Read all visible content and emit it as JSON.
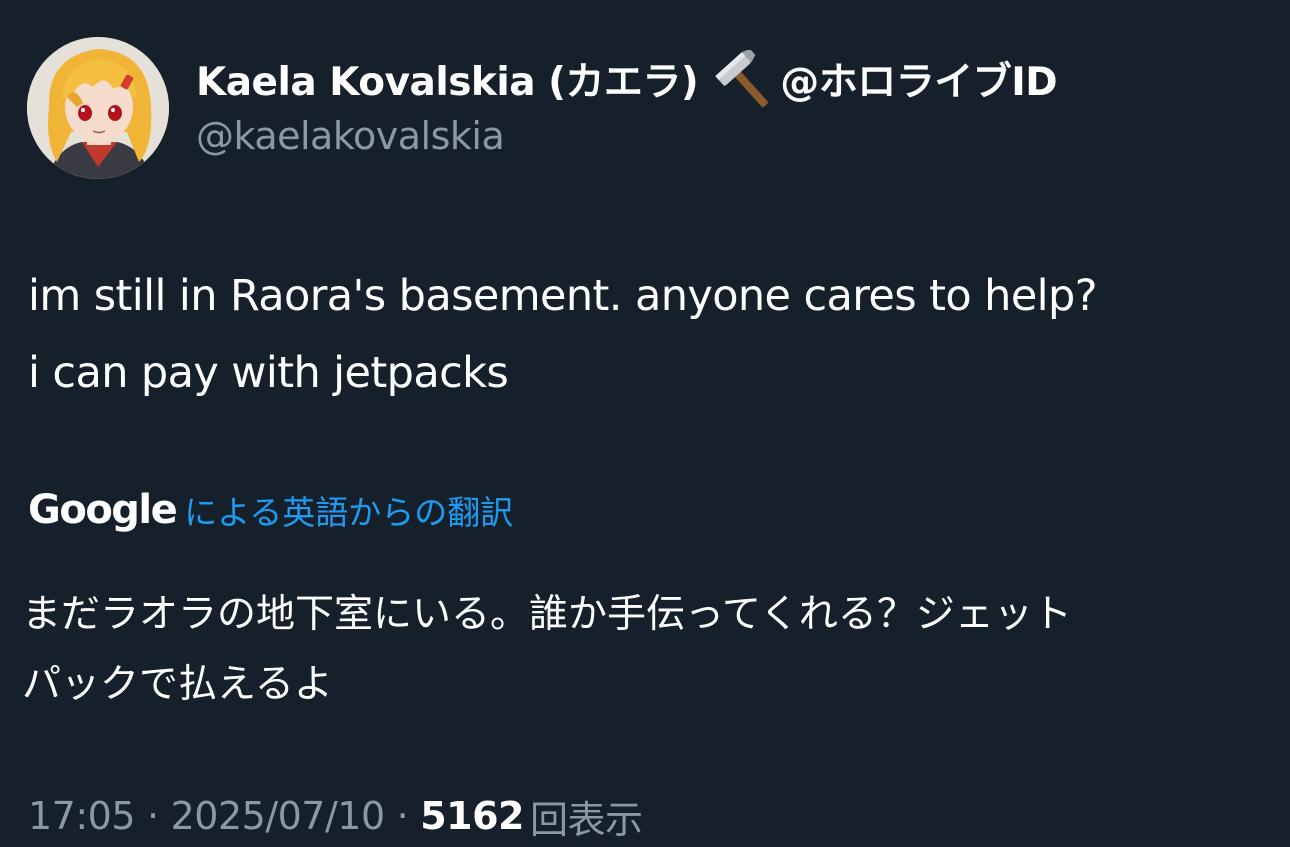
{
  "tweet": {
    "author": {
      "display_name": "Kaela Kovalskia (カエラ)",
      "name_emoji": "hammer-icon",
      "name_suffix": "@ホロライブID",
      "handle": "@kaelakovalskia"
    },
    "text_lines": [
      "im still in Raora's basement. anyone cares to help?",
      "i can pay with jetpacks"
    ],
    "translation": {
      "provider": "Google",
      "label": "による英語からの翻訳",
      "text_lines": [
        "まだラオラの地下室にいる。誰か手伝ってくれる？ジェット",
        "パックで払えるよ"
      ]
    },
    "meta": {
      "time": "17:05",
      "separator": "·",
      "date": "2025/07/10",
      "views_count": "5162",
      "views_label": "回表示"
    }
  },
  "colors": {
    "background": "#15202b",
    "primary_text": "#ffffff",
    "secondary_text": "#8b98a5",
    "link": "#1d9bf0"
  }
}
